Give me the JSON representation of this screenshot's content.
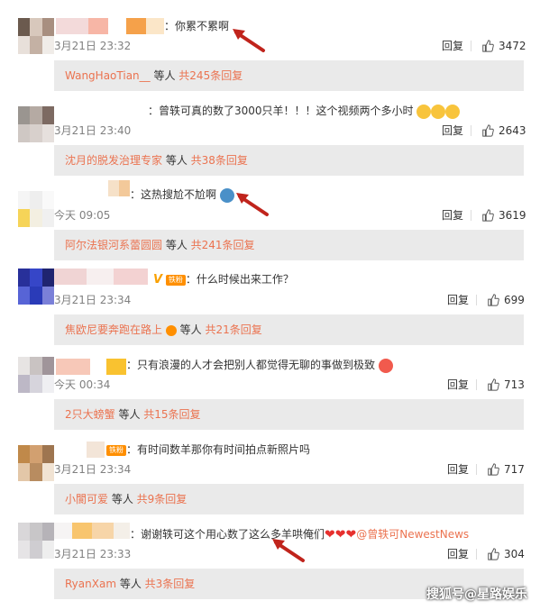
{
  "comments": [
    {
      "text": "：你累不累啊",
      "time": "3月21日 23:32",
      "reply_label": "回复",
      "likes": "3472",
      "subreply": {
        "name": "WangHaoTian__",
        "mid": " 等人 ",
        "count": "共245条回复"
      }
    },
    {
      "text": "：曾轶可真的数了3000只羊！！！这个视频两个多小时",
      "time": "3月21日 23:40",
      "reply_label": "回复",
      "likes": "2643",
      "subreply": {
        "name": "沈月的脱发治理专家",
        "mid": " 等人 ",
        "count": "共38条回复"
      }
    },
    {
      "text": "：这热搜尬不尬啊",
      "time": "今天 09:05",
      "reply_label": "回复",
      "likes": "3619",
      "subreply": {
        "name": "阿尔法银河系蕾圆圆",
        "mid": " 等人 ",
        "count": "共241条回复"
      }
    },
    {
      "text": "：什么时候出来工作？",
      "badge_fan": "铁粉",
      "badge_v": "V",
      "time": "3月21日 23:34",
      "reply_label": "回复",
      "likes": "699",
      "subreply": {
        "name": "焦欧尼要奔跑在路上",
        "mid": " 等人 ",
        "count": "共21条回复"
      }
    },
    {
      "text": "：只有浪漫的人才会把别人都觉得无聊的事做到极致",
      "time": "今天 00:34",
      "reply_label": "回复",
      "likes": "713",
      "subreply": {
        "name": "2只大螃蟹",
        "mid": " 等人 ",
        "count": "共15条回复"
      }
    },
    {
      "text": "：有时间数羊那你有时间拍点新照片吗",
      "badge_fan": "铁粉",
      "time": "3月21日 23:34",
      "reply_label": "回复",
      "likes": "717",
      "subreply": {
        "name": "小閬可爱",
        "mid": " 等人 ",
        "count": "共9条回复"
      }
    },
    {
      "text": "：谢谢轶可这个用心数了这么多羊哄俺们",
      "mention": "@曾轶可NewestNews",
      "time": "3月21日 23:33",
      "reply_label": "回复",
      "likes": "304",
      "subreply": {
        "name": "RyanXam",
        "mid": " 等人 ",
        "count": "共3条回复"
      }
    }
  ],
  "watermark": "搜狐号@星路娱乐",
  "colors": {
    "accent": "#eb7350",
    "subreply_bg": "#eaeaea",
    "arrow": "#c0241c"
  },
  "icons": {
    "like": "thumbs-up-icon",
    "arrow": "red-arrow-annotation",
    "emoji": "smiley-emoji-icon"
  }
}
